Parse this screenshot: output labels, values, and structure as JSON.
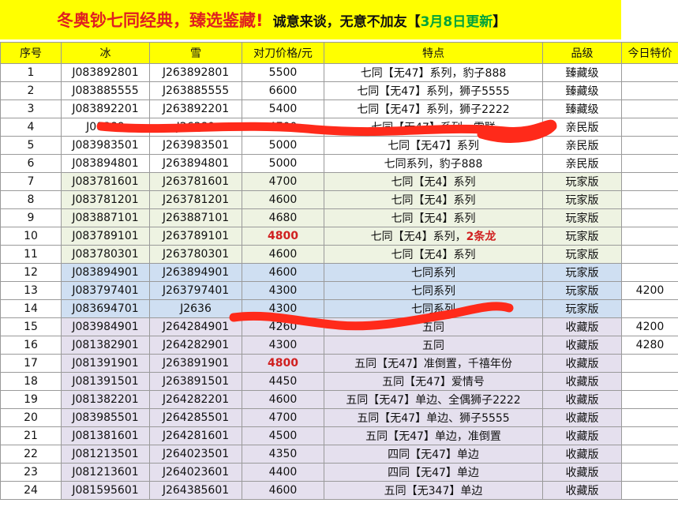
{
  "banner": {
    "title": "冬奥钞七同经典，臻选鉴藏!",
    "note": "诚意来谈，无意不加友",
    "bracket_open": "【",
    "update": "3月8日更新",
    "bracket_close": "】"
  },
  "table": {
    "headers": [
      "序号",
      "冰",
      "雪",
      "对刀价格/元",
      "特点",
      "品级",
      "今日特价"
    ],
    "rows": [
      {
        "no": "1",
        "ice": "J083892801",
        "snow": "J263892801",
        "price": "5500",
        "feature": "七同【无47】系列，豹子888",
        "feature_hl": "",
        "grade": "臻藏级",
        "special": "",
        "group": "white"
      },
      {
        "no": "2",
        "ice": "J083885555",
        "snow": "J263885555",
        "price": "6600",
        "feature": "七同【无47】系列，狮子5555",
        "feature_hl": "",
        "grade": "臻藏级",
        "special": "",
        "group": "white"
      },
      {
        "no": "3",
        "ice": "J083892201",
        "snow": "J263892201",
        "price": "5400",
        "feature": "七同【无47】系列，狮子2222",
        "feature_hl": "",
        "grade": "臻藏级",
        "special": "",
        "group": "white"
      },
      {
        "no": "4",
        "ice": "J08389",
        "snow": "J26389",
        "price": "4700",
        "feature": "七同【无47】系列，雪联",
        "feature_hl": "",
        "grade": "亲民版",
        "special": "",
        "group": "white"
      },
      {
        "no": "5",
        "ice": "J083983501",
        "snow": "J263983501",
        "price": "5000",
        "feature": "七同【无47】系列",
        "feature_hl": "",
        "grade": "亲民版",
        "special": "",
        "group": "white"
      },
      {
        "no": "6",
        "ice": "J083894801",
        "snow": "J263894801",
        "price": "5000",
        "feature": "七同系列，豹子888",
        "feature_hl": "",
        "grade": "亲民版",
        "special": "",
        "group": "white"
      },
      {
        "no": "7",
        "ice": "J083781601",
        "snow": "J263781601",
        "price": "4700",
        "feature": "七同【无4】系列",
        "feature_hl": "",
        "grade": "玩家版",
        "special": "",
        "group": "green"
      },
      {
        "no": "8",
        "ice": "J083781201",
        "snow": "J263781201",
        "price": "4600",
        "feature": "七同【无4】系列",
        "feature_hl": "",
        "grade": "玩家版",
        "special": "",
        "group": "green"
      },
      {
        "no": "9",
        "ice": "J083887101",
        "snow": "J263887101",
        "price": "4680",
        "feature": "七同【无4】系列",
        "feature_hl": "",
        "grade": "玩家版",
        "special": "",
        "group": "green"
      },
      {
        "no": "10",
        "ice": "J083789101",
        "snow": "J263789101",
        "price": "4800",
        "price_red": true,
        "feature": "七同【无4】系列，",
        "feature_hl": "2条龙",
        "grade": "玩家版",
        "special": "",
        "group": "green"
      },
      {
        "no": "11",
        "ice": "J083780301",
        "snow": "J263780301",
        "price": "4600",
        "feature": "七同【无4】系列",
        "feature_hl": "",
        "grade": "玩家版",
        "special": "",
        "group": "green"
      },
      {
        "no": "12",
        "ice": "J083894901",
        "snow": "J263894901",
        "price": "4600",
        "feature": "七同系列",
        "feature_hl": "",
        "grade": "玩家版",
        "special": "",
        "group": "blue"
      },
      {
        "no": "13",
        "ice": "J083797401",
        "snow": "J263797401",
        "price": "4300",
        "feature": "七同系列",
        "feature_hl": "",
        "grade": "玩家版",
        "special": "4200",
        "group": "blue"
      },
      {
        "no": "14",
        "ice": "J083694701",
        "snow": "J2636",
        "price": "4300",
        "feature": "七同系列",
        "feature_hl": "",
        "grade": "玩家版",
        "special": "",
        "group": "blue"
      },
      {
        "no": "15",
        "ice": "J083984901",
        "snow": "J264284901",
        "price": "4260",
        "feature": "五同",
        "feature_hl": "",
        "grade": "收藏版",
        "special": "4200",
        "group": "purple"
      },
      {
        "no": "16",
        "ice": "J081382901",
        "snow": "J264282901",
        "price": "4300",
        "feature": "五同",
        "feature_hl": "",
        "grade": "收藏版",
        "special": "4280",
        "group": "purple"
      },
      {
        "no": "17",
        "ice": "J081391901",
        "snow": "J263891901",
        "price": "4800",
        "price_red": true,
        "feature": "五同【无47】准倒置，千禧年份",
        "feature_hl": "",
        "grade": "收藏版",
        "special": "",
        "group": "purple"
      },
      {
        "no": "18",
        "ice": "J081391501",
        "snow": "J263891501",
        "price": "4450",
        "feature": "五同【无47】爱情号",
        "feature_hl": "",
        "grade": "收藏版",
        "special": "",
        "group": "purple"
      },
      {
        "no": "19",
        "ice": "J081382201",
        "snow": "J264282201",
        "price": "4600",
        "feature": "五同【无47】单边、全偶狮子2222",
        "feature_hl": "",
        "grade": "收藏版",
        "special": "",
        "group": "purple"
      },
      {
        "no": "20",
        "ice": "J083985501",
        "snow": "J264285501",
        "price": "4700",
        "feature": "五同【无47】单边、狮子5555",
        "feature_hl": "",
        "grade": "收藏版",
        "special": "",
        "group": "purple"
      },
      {
        "no": "21",
        "ice": "J081381601",
        "snow": "J264281601",
        "price": "4500",
        "feature": "五同【无47】单边，准倒置",
        "feature_hl": "",
        "grade": "收藏版",
        "special": "",
        "group": "purple"
      },
      {
        "no": "22",
        "ice": "J081213501",
        "snow": "J264023501",
        "price": "4350",
        "feature": "四同【无47】单边",
        "feature_hl": "",
        "grade": "收藏版",
        "special": "",
        "group": "purple"
      },
      {
        "no": "23",
        "ice": "J081213601",
        "snow": "J264023601",
        "price": "4400",
        "feature": "四同【无47】单边",
        "feature_hl": "",
        "grade": "收藏版",
        "special": "",
        "group": "purple"
      },
      {
        "no": "24",
        "ice": "J081595601",
        "snow": "J264385601",
        "price": "4600",
        "feature": "五同【无347】单边",
        "feature_hl": "",
        "grade": "收藏版",
        "special": "",
        "group": "purple"
      }
    ]
  },
  "colors": {
    "banner_bg": "#ffff00",
    "title_red": "#e02020",
    "update_green": "#00a33a",
    "highlight_red": "#d02020",
    "scribble": "#ff2a1a"
  }
}
